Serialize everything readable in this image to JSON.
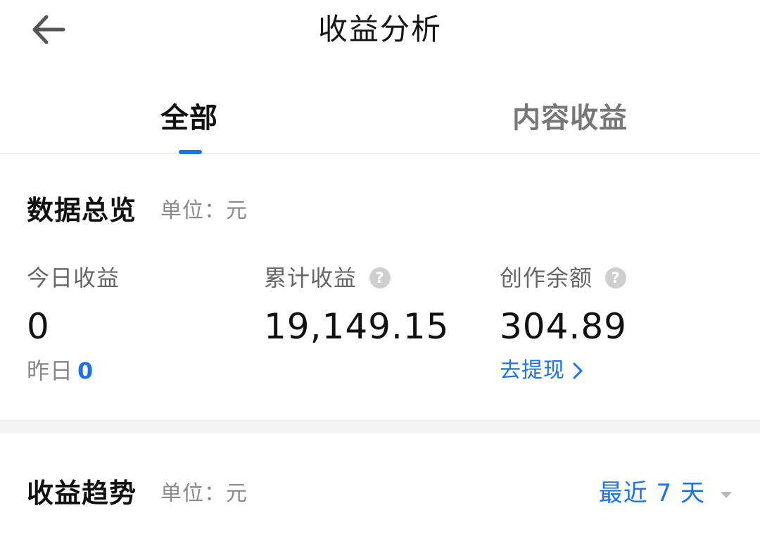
{
  "header": {
    "title": "收益分析",
    "back_icon": "arrow-left-icon"
  },
  "tabs": [
    {
      "label": "全部",
      "active": true
    },
    {
      "label": "内容收益",
      "active": false
    }
  ],
  "overview": {
    "title": "数据总览",
    "unit": "单位：元",
    "today": {
      "label": "今日收益",
      "value": "0"
    },
    "yesterday": {
      "label": "昨日",
      "value": "0"
    },
    "total": {
      "label": "累计收益",
      "value": "19,149.15",
      "help_icon": "question-icon"
    },
    "balance": {
      "label": "创作余额",
      "value": "304.89",
      "help_icon": "question-icon"
    },
    "withdraw_label": "去提现"
  },
  "trend": {
    "title": "收益趋势",
    "unit": "单位：元",
    "range_label": "最近 7 天"
  },
  "colors": {
    "accent": "#1a73e8",
    "muted": "#888888",
    "band": "#f4f4f4"
  }
}
